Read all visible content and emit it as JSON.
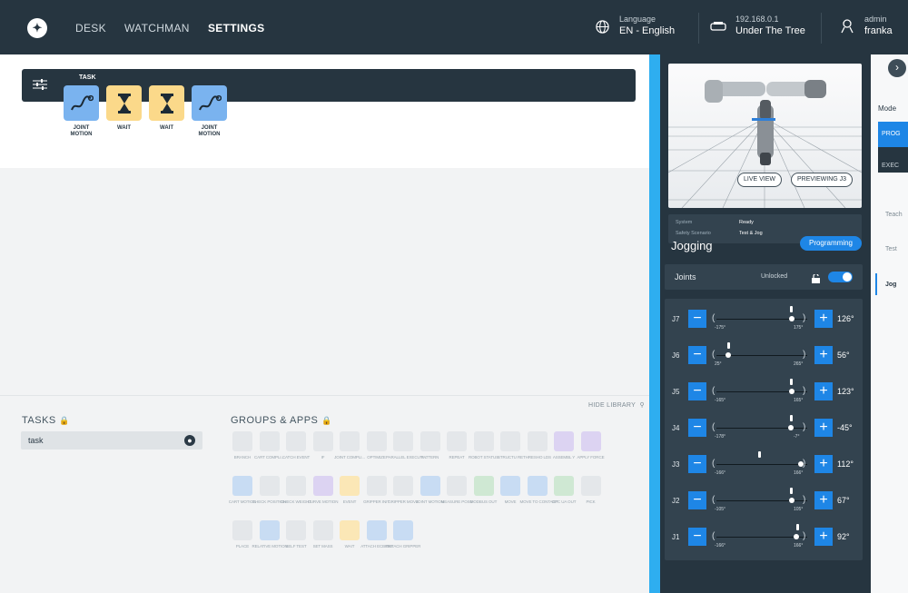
{
  "topbar": {
    "nav": [
      "DESK",
      "WATCHMAN",
      "SETTINGS"
    ],
    "active_nav": "SETTINGS",
    "language_label": "Language",
    "language_value": "EN - English",
    "ip": "192.168.0.1",
    "robot_name": "Under The Tree",
    "user_role": "admin",
    "user_name": "franka"
  },
  "task": {
    "label": "TASK",
    "apps": [
      {
        "label": "JOINT MOTION",
        "color": "#7ab3ef",
        "icon": "joint-motion-icon"
      },
      {
        "label": "WAIT",
        "color": "#fbd98a",
        "icon": "hourglass-icon"
      },
      {
        "label": "WAIT",
        "color": "#fbd98a",
        "icon": "hourglass-icon"
      },
      {
        "label": "JOINT MOTION",
        "color": "#7ab3ef",
        "icon": "joint-motion-icon"
      }
    ]
  },
  "library": {
    "hide_label": "HIDE LIBRARY",
    "tasks_title": "TASKS",
    "task_items": [
      "task"
    ],
    "groups_title": "GROUPS & APPS",
    "apps": [
      {
        "label": "BRANCH",
        "tone": "grey"
      },
      {
        "label": "CART COMPLI...",
        "tone": "grey"
      },
      {
        "label": "CATCH EVENT",
        "tone": "grey"
      },
      {
        "label": "IF",
        "tone": "grey"
      },
      {
        "label": "JOINT COMPLI...",
        "tone": "grey"
      },
      {
        "label": "OPTIMIZE",
        "tone": "grey"
      },
      {
        "label": "PARALLEL EXECUTI...",
        "tone": "grey"
      },
      {
        "label": "PATTERN",
        "tone": "grey"
      },
      {
        "label": "REPEAT",
        "tone": "grey"
      },
      {
        "label": "ROBOT STATUS",
        "tone": "grey"
      },
      {
        "label": "STRUCTU RE",
        "tone": "grey"
      },
      {
        "label": "THRESHO LDS",
        "tone": "grey"
      },
      {
        "label": "ASSEMBL Y",
        "tone": "purple"
      },
      {
        "label": "APPLY FORCE",
        "tone": "purple"
      },
      {
        "label": "CART MOTION",
        "tone": "blue"
      },
      {
        "label": "CHECK POSITION",
        "tone": "grey"
      },
      {
        "label": "CHECK WEIGHT",
        "tone": "grey"
      },
      {
        "label": "CURVE MOTION",
        "tone": "purple"
      },
      {
        "label": "EVENT",
        "tone": "yellow"
      },
      {
        "label": "GRIPPER INIT",
        "tone": "grey"
      },
      {
        "label": "GRIPPER MOVE",
        "tone": "grey"
      },
      {
        "label": "JOINT MOTION",
        "tone": "blue"
      },
      {
        "label": "MEASURE POSE",
        "tone": "grey"
      },
      {
        "label": "MODBUS OUT",
        "tone": "green"
      },
      {
        "label": "MOVE",
        "tone": "blue"
      },
      {
        "label": "MOVE TO CONTACT",
        "tone": "blue"
      },
      {
        "label": "OPC UA OUT",
        "tone": "green"
      },
      {
        "label": "PICK",
        "tone": "grey"
      },
      {
        "label": "PLACE",
        "tone": "grey"
      },
      {
        "label": "RELATIVE MOTION",
        "tone": "blue"
      },
      {
        "label": "SELF TEST",
        "tone": "grey"
      },
      {
        "label": "SET MASS",
        "tone": "grey"
      },
      {
        "label": "WAIT",
        "tone": "yellow"
      },
      {
        "label": "ATTACH ECBPMI",
        "tone": "blue"
      },
      {
        "label": "DETACH GRIPPER",
        "tone": "blue"
      }
    ]
  },
  "right": {
    "live_view": "LIVE VIEW",
    "previewing": "PREVIEWING J3",
    "system_label": "System",
    "system_value": "Ready",
    "scenario_label": "Safety Scenario",
    "scenario_value": "Test & Jog",
    "jogging_title": "Jogging",
    "mode_button": "Programming",
    "joints_label": "Joints",
    "unlocked_label": "Unlocked",
    "joints": [
      {
        "name": "J7",
        "min": "-175°",
        "max": "175°",
        "value": "126°",
        "pos": 0.83,
        "mark": 0.82
      },
      {
        "name": "J6",
        "min": "25°",
        "max": "265°",
        "value": "56°",
        "pos": 0.13,
        "mark": 0.13
      },
      {
        "name": "J5",
        "min": "-165°",
        "max": "165°",
        "value": "123°",
        "pos": 0.83,
        "mark": 0.82
      },
      {
        "name": "J4",
        "min": "-178°",
        "max": "-7°",
        "value": "-45°",
        "pos": 0.82,
        "mark": 0.82
      },
      {
        "name": "J3",
        "min": "-166°",
        "max": "166°",
        "value": "112°",
        "pos": 0.93,
        "mark": 0.47
      },
      {
        "name": "J2",
        "min": "-105°",
        "max": "105°",
        "value": "67°",
        "pos": 0.83,
        "mark": 0.82
      },
      {
        "name": "J1",
        "min": "-166°",
        "max": "166°",
        "value": "92°",
        "pos": 0.88,
        "mark": 0.89
      }
    ]
  },
  "sidebar": {
    "mode_label": "Mode",
    "prog": "PROG",
    "exec": "EXEC",
    "teach": "Teach",
    "test": "Test",
    "jog": "Jog"
  }
}
